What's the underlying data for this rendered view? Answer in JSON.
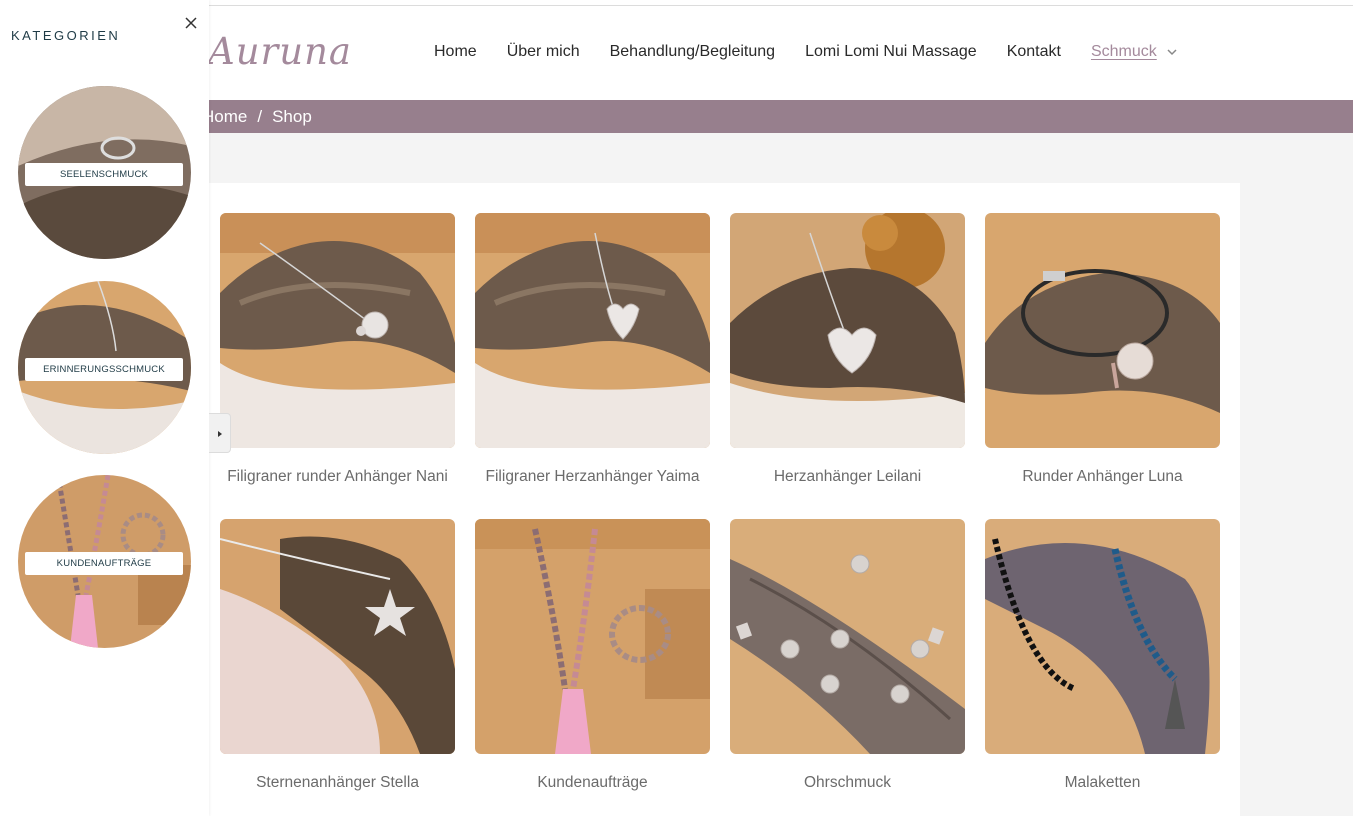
{
  "header": {
    "logo": "Auruna",
    "nav": [
      {
        "label": "Home"
      },
      {
        "label": "Über mich"
      },
      {
        "label": "Behandlung/Begleitung"
      },
      {
        "label": "Lomi Lomi Nui Massage"
      },
      {
        "label": "Kontakt"
      }
    ],
    "active_nav": "Schmuck"
  },
  "breadcrumb": {
    "home": "Home",
    "separator": "/",
    "current": "Shop"
  },
  "sidebar": {
    "title": "KATEGORIEN",
    "close_icon": "close-icon",
    "categories": [
      {
        "label": "SEELENSCHMUCK"
      },
      {
        "label": "ERINNERUNGSSCHMUCK"
      },
      {
        "label": "KUNDENAUFTRÄGE"
      }
    ]
  },
  "products": [
    {
      "title": "Filigraner runder Anhänger Nani"
    },
    {
      "title": "Filigraner Herzanhänger Yaima"
    },
    {
      "title": "Herzanhänger Leilani"
    },
    {
      "title": "Runder Anhänger Luna"
    },
    {
      "title": "Sternenanhänger Stella"
    },
    {
      "title": "Kundenaufträge"
    },
    {
      "title": "Ohrschmuck"
    },
    {
      "title": "Malaketten"
    }
  ],
  "colors": {
    "accent": "#977f8d",
    "logo": "#a48a9c",
    "heading": "#1f3b46",
    "wood": "#d4a06a"
  }
}
